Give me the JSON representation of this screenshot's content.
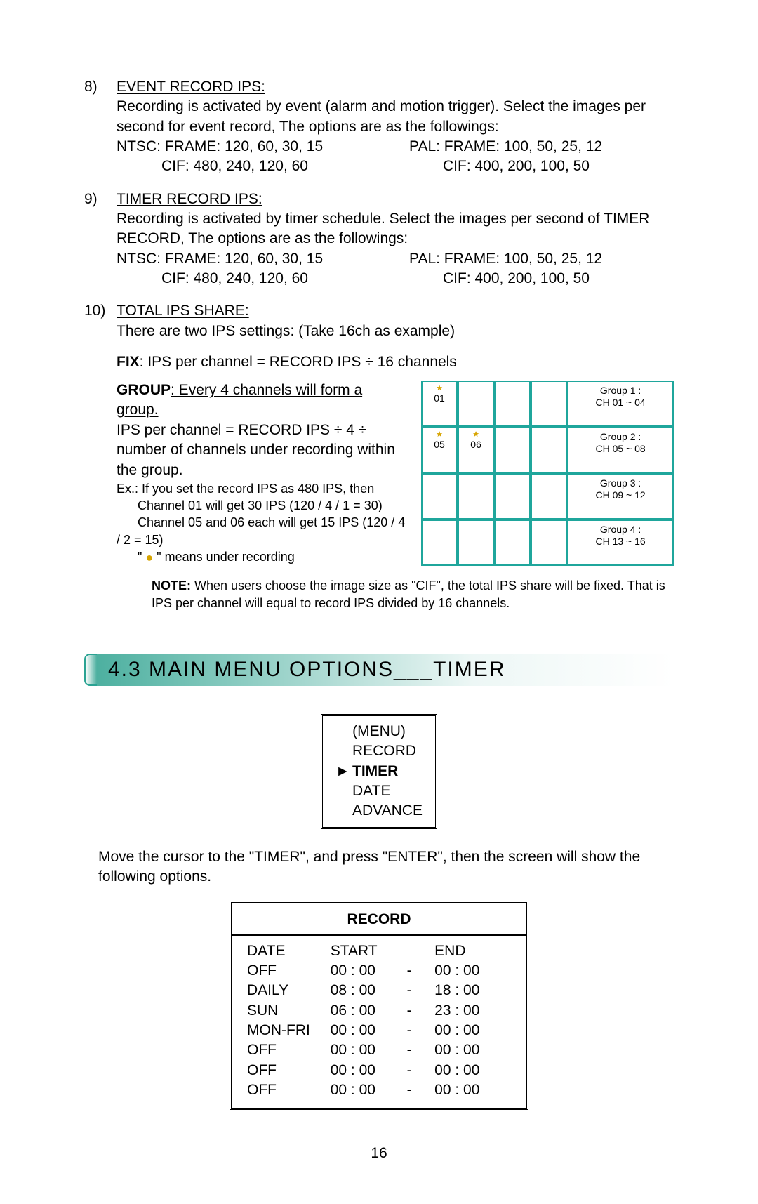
{
  "sections": {
    "item8": {
      "num": "8)",
      "title": "EVENT RECORD IPS:",
      "line1": "Recording is activated by event (alarm and motion trigger). Select the images per second for event record, The options are as the followings:",
      "ntsc_frame": "NTSC: FRAME: 120, 60, 30, 15",
      "ntsc_cif": "CIF: 480, 240, 120, 60",
      "pal_frame": "PAL: FRAME: 100, 50, 25, 12",
      "pal_cif": "CIF: 400, 200, 100, 50"
    },
    "item9": {
      "num": "9)",
      "title": "TIMER RECORD IPS:",
      "line1": "Recording is activated by timer schedule. Select the images per second of TIMER RECORD, The options are as the followings:",
      "ntsc_frame": "NTSC: FRAME: 120, 60, 30, 15",
      "ntsc_cif": "CIF: 480, 240, 120, 60",
      "pal_frame": "PAL: FRAME: 100, 50, 25, 12",
      "pal_cif": "CIF: 400, 200, 100, 50"
    },
    "item10": {
      "num": "10)",
      "title": "TOTAL IPS SHARE:",
      "line1": "There are two IPS settings: (Take 16ch as example)",
      "fix_label": "FIX",
      "fix_text": ": IPS per channel = RECORD IPS ÷ 16 channels",
      "group_label": "GROUP",
      "group_underline": ": Every 4 channels will form a group.",
      "group_text1": "IPS per channel = RECORD IPS ÷  4 ÷  number of channels under recording within the group.",
      "ex_intro": "Ex.: If you set the record IPS as 480 IPS, then",
      "ex_l1": "Channel 01 will get 30 IPS (120 / 4 / 1 = 30)",
      "ex_l2": "Channel 05 and 06 each will get 15 IPS (120 / 4 / 2 = 15)",
      "legend_open": "\" ",
      "legend_close": "  \" means under recording",
      "note_label": "NOTE:",
      "note_text": " When users choose the image size as \"CIF\", the total IPS share will be fixed. That is IPS per channel will equal to record IPS divided by 16 channels."
    }
  },
  "group_table": {
    "rows": [
      {
        "cells": [
          "01",
          "",
          "",
          ""
        ],
        "dots": [
          true,
          false,
          false,
          false
        ],
        "label_l1": "Group 1 :",
        "label_l2": "CH 01 ~  04"
      },
      {
        "cells": [
          "05",
          "06",
          "",
          ""
        ],
        "dots": [
          true,
          true,
          false,
          false
        ],
        "label_l1": "Group 2 :",
        "label_l2": "CH 05 ~  08"
      },
      {
        "cells": [
          "",
          "",
          "",
          ""
        ],
        "dots": [
          false,
          false,
          false,
          false
        ],
        "label_l1": "Group 3 :",
        "label_l2": "CH 09 ~  12"
      },
      {
        "cells": [
          "",
          "",
          "",
          ""
        ],
        "dots": [
          false,
          false,
          false,
          false
        ],
        "label_l1": "Group 4 :",
        "label_l2": "CH 13 ~  16"
      }
    ]
  },
  "heading": {
    "text": "4.3 MAIN MENU OPTIONS___TIMER"
  },
  "menu_box": {
    "head": "(MENU)",
    "items": [
      {
        "arrow": "",
        "label": "RECORD",
        "bold": false
      },
      {
        "arrow": "►",
        "label": "TIMER",
        "bold": true
      },
      {
        "arrow": "",
        "label": "DATE",
        "bold": false
      },
      {
        "arrow": "",
        "label": "ADVANCE",
        "bold": false
      }
    ]
  },
  "menu_para": "Move the cursor to the \"TIMER\", and press \"ENTER\", then the screen will show the following options.",
  "record_box": {
    "title": "RECORD",
    "header": {
      "c1": "DATE",
      "c2": "START",
      "c3": "END"
    },
    "rows": [
      {
        "c1": "OFF",
        "c2": "00 : 00",
        "dash": "-",
        "c3": "00 : 00"
      },
      {
        "c1": "DAILY",
        "c2": "08 : 00",
        "dash": "-",
        "c3": "18 : 00"
      },
      {
        "c1": "SUN",
        "c2": "06 : 00",
        "dash": "-",
        "c3": "23 : 00"
      },
      {
        "c1": "MON-FRI",
        "c2": "00 : 00",
        "dash": "-",
        "c3": "00 : 00"
      },
      {
        "c1": "OFF",
        "c2": "00 : 00",
        "dash": "-",
        "c3": "00 : 00"
      },
      {
        "c1": "OFF",
        "c2": "00 : 00",
        "dash": "-",
        "c3": "00 : 00"
      },
      {
        "c1": "OFF",
        "c2": "00 : 00",
        "dash": "-",
        "c3": "00 : 00"
      }
    ]
  },
  "page_number": "16"
}
